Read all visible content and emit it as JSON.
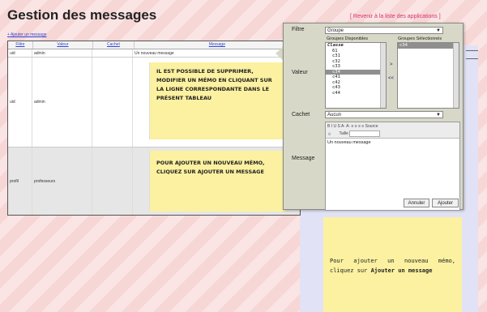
{
  "page": {
    "title": "Gestion des messages",
    "back_link": "[ Revenir à la liste des applications ]",
    "add_link": "+ Ajouter un message"
  },
  "table": {
    "headers": [
      "Filtre",
      "Valeur",
      "Cachet",
      "Message"
    ],
    "rows": [
      {
        "filtre": "uid",
        "valeur": "admin",
        "cachet": "",
        "message": "Un nouveau message"
      },
      {
        "filtre": "uid",
        "valeur": "admin",
        "cachet": "",
        "message": "Il est possible de supprimer, modifier un mémo en cliquant sur la ligne correspondante dans le présent tableau"
      },
      {
        "filtre": "profil",
        "valeur": "professeurs",
        "cachet": "",
        "message": "Pour ajouter un nouveau mémo, cliquez sur Ajouter un message"
      }
    ]
  },
  "dialog": {
    "filtre_label": "Filtre",
    "filtre_value": "Groupe",
    "valeur_label": "Valeur",
    "dispo_label": "Groupes Disponibles",
    "selected_label": "Groupes Sélectionnés",
    "group_header": "Classe",
    "groups": [
      "61",
      "c31",
      "c32",
      "c33",
      "c34",
      "c41",
      "c42",
      "c43",
      "c44"
    ],
    "selected_group": "c34",
    "selected_groups": [
      "c34"
    ],
    "move_right": ">",
    "move_left": "<<",
    "cachet_label": "Cachet",
    "cachet_value": "Aucun",
    "message_label": "Message",
    "toolbar_line1": "B  I  U  S  A·  A·  ≡  ≡  ≡  ≡  Source",
    "toolbar_size_label": "Taille",
    "message_text": "Un nouveau message",
    "cancel_label": "Annuler",
    "ok_label": "Ajouter"
  },
  "side_note": {
    "text_before": "Pour ajouter un nouveau mémo, cliquez sur ",
    "text_bold": "Ajouter un message"
  },
  "colors": {
    "accent": "#d6336c",
    "link": "#3344cc",
    "note": "#fbf1a0",
    "background": "#f7d6d6"
  }
}
